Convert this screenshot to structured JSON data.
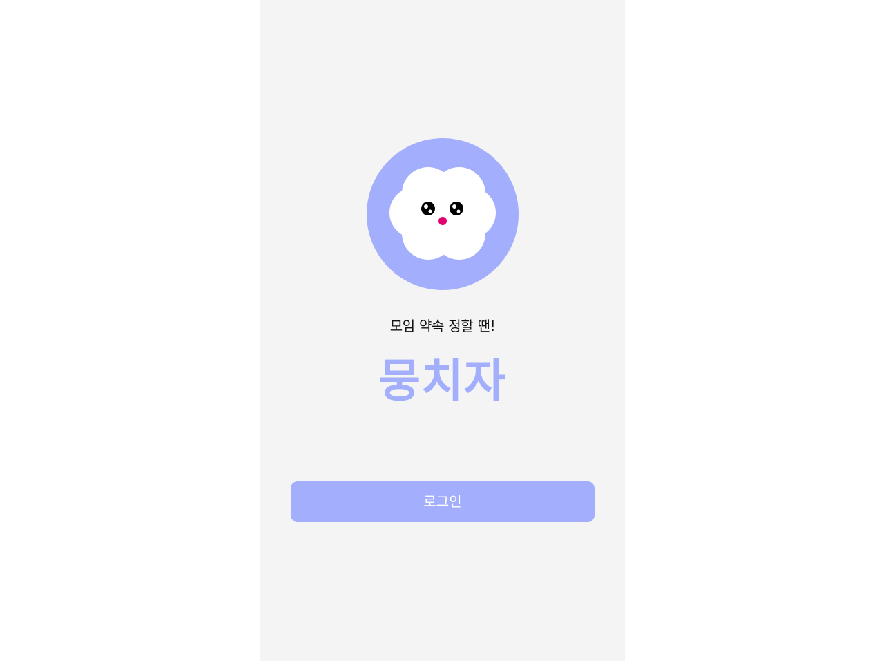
{
  "colors": {
    "accent": "#a3aefc",
    "screen_background": "#f4f4f4",
    "logo_face": "#ffffff",
    "logo_eye": "#000000",
    "logo_nose": "#e0006e",
    "button_text": "#ffffff"
  },
  "logo": {
    "icon": "cloud-mascot-icon"
  },
  "tagline": "모임 약속 정할 땐!",
  "app_name": "뭉치자",
  "login_button": {
    "label": "로그인"
  }
}
